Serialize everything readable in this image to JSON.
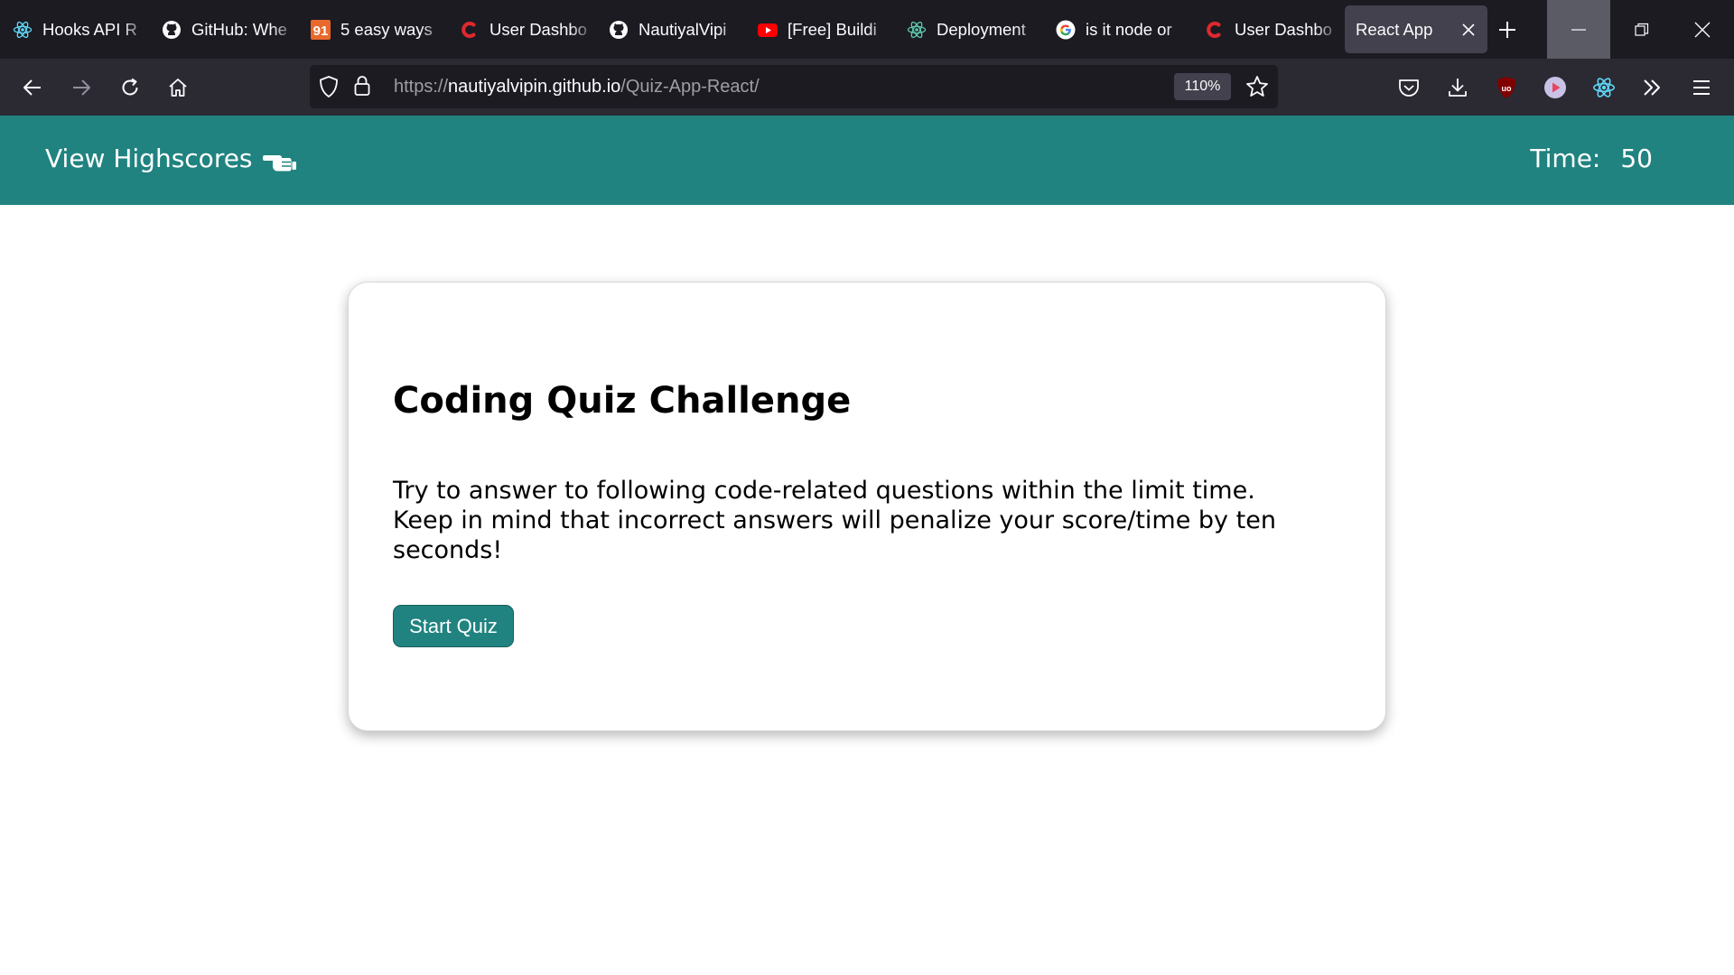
{
  "browser": {
    "tabs": [
      {
        "title": "Hooks API R",
        "icon": "react-icon"
      },
      {
        "title": "GitHub: Whe",
        "icon": "github-icon"
      },
      {
        "title": "5 easy ways",
        "icon": "91-icon",
        "badge": "91"
      },
      {
        "title": "User Dashbo",
        "icon": "c-logo-icon"
      },
      {
        "title": "NautiyalVipi",
        "icon": "github-icon"
      },
      {
        "title": "[Free] Buildi",
        "icon": "youtube-icon"
      },
      {
        "title": "Deployment",
        "icon": "react-icon"
      },
      {
        "title": "is it node or",
        "icon": "google-icon"
      },
      {
        "title": "User Dashbo",
        "icon": "c-logo-icon"
      }
    ],
    "active_tab": {
      "title": "React App"
    },
    "url": {
      "prefix": "https://",
      "host": "nautiyalvipin.github.io",
      "path": "/Quiz-App-React/"
    },
    "zoom": "110%"
  },
  "header": {
    "highscores_label": "View Highscores",
    "timer_label": "Time:",
    "timer_value": "50"
  },
  "quiz": {
    "title": "Coding Quiz Challenge",
    "description": "Try to answer to following code-related questions within the limit time. Keep in mind that incorrect answers will penalize your score/time by ten seconds!",
    "start_button": "Start Quiz"
  },
  "colors": {
    "accent": "#208380",
    "tabbar": "#1c1b22",
    "navbar": "#2b2a33"
  }
}
